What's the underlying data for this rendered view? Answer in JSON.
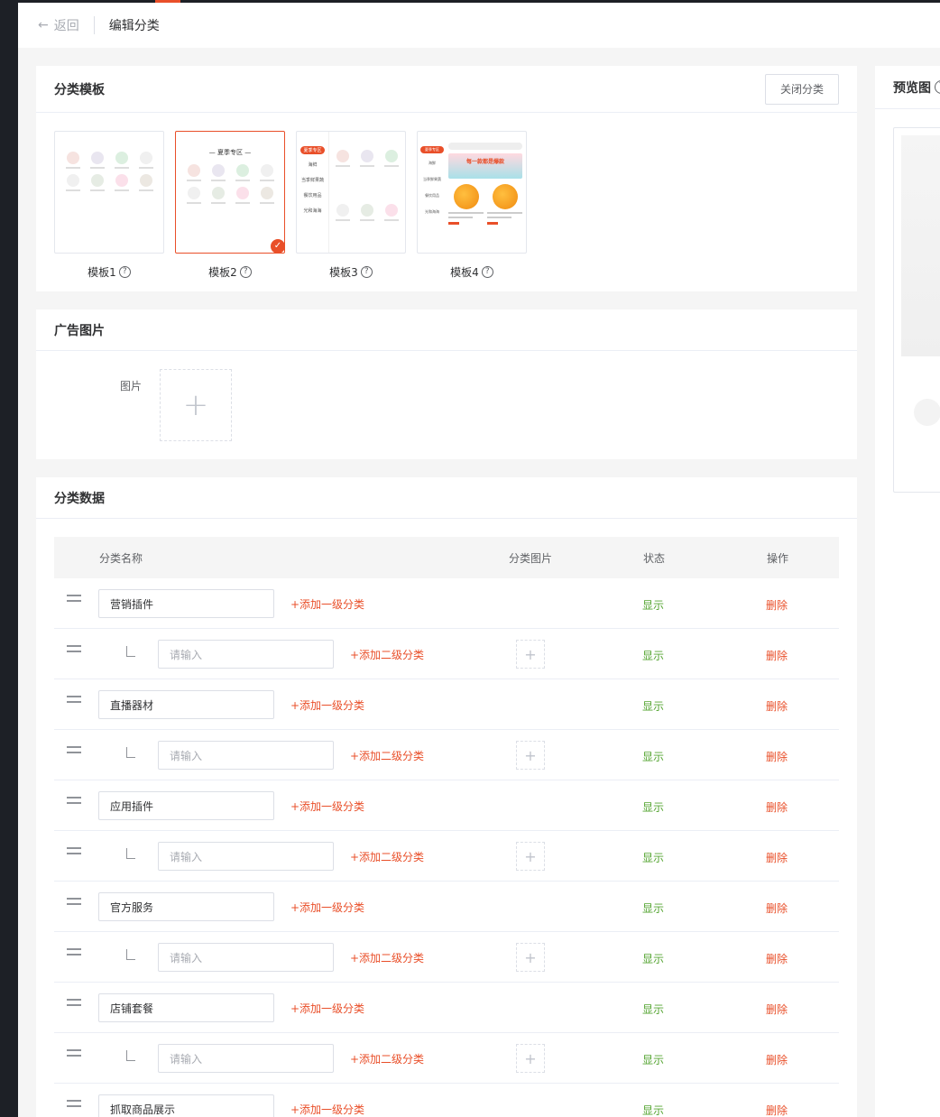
{
  "header": {
    "back_label": "返回",
    "title": "编辑分类"
  },
  "template_card": {
    "title": "分类模板",
    "close_button": "关闭分类",
    "templates": [
      {
        "label": "模板1",
        "selected": false
      },
      {
        "label": "模板2",
        "selected": true,
        "heading": "— 夏季专区 —"
      },
      {
        "label": "模板3",
        "selected": false,
        "side": [
          "夏季专区",
          "海鲜",
          "当季鲜果蔬",
          "餐饮用品",
          "光和海海"
        ]
      },
      {
        "label": "模板4",
        "selected": false,
        "side": [
          "夏季专区",
          "海鲜",
          "当季鲜果蔬",
          "餐饮用品",
          "光和海海"
        ],
        "banner": "每一款都是爆款"
      }
    ]
  },
  "ad_card": {
    "title": "广告图片",
    "image_label": "图片"
  },
  "data_card": {
    "title": "分类数据",
    "columns": {
      "name": "分类名称",
      "image": "分类图片",
      "status": "状态",
      "action": "操作"
    },
    "placeholder": "请输入",
    "add_level1": "+添加一级分类",
    "add_level2": "+添加二级分类",
    "status_text": "显示",
    "delete_text": "删除",
    "rows": [
      {
        "level": 1,
        "name": "营销插件"
      },
      {
        "level": 2,
        "name": ""
      },
      {
        "level": 1,
        "name": "直播器材"
      },
      {
        "level": 2,
        "name": ""
      },
      {
        "level": 1,
        "name": "应用插件"
      },
      {
        "level": 2,
        "name": ""
      },
      {
        "level": 1,
        "name": "官方服务"
      },
      {
        "level": 2,
        "name": ""
      },
      {
        "level": 1,
        "name": "店铺套餐"
      },
      {
        "level": 2,
        "name": ""
      },
      {
        "level": 1,
        "name": "抓取商品展示"
      }
    ]
  },
  "preview": {
    "title": "预览图"
  },
  "colors": {
    "accent": "#e94f29",
    "status_green": "#55a532"
  }
}
